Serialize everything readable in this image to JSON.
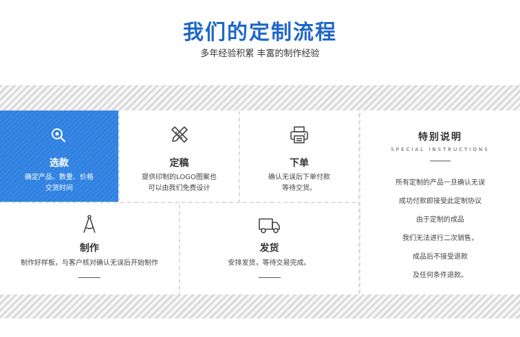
{
  "header": {
    "title": "我们的定制流程",
    "subtitle": "多年经验积累 丰富的制作经验"
  },
  "steps": [
    {
      "title": "选款",
      "desc_lines": [
        "确定产品、数量、价格",
        "交货时间"
      ],
      "icon": "search-icon"
    },
    {
      "title": "定稿",
      "desc_lines": [
        "提供印制的LOGO图案也",
        "可以由我们免费设计"
      ],
      "icon": "pencil-ruler-icon"
    },
    {
      "title": "下单",
      "desc_lines": [
        "确认无误后下单付款",
        "等待交货。"
      ],
      "icon": "printer-icon"
    },
    {
      "title": "制作",
      "desc_lines": [
        "制作好样板，与客户核对确认无误后开始制作"
      ],
      "icon": "compass-icon"
    },
    {
      "title": "发货",
      "desc_lines": [
        "安排发货，等待交易完成。"
      ],
      "icon": "truck-icon"
    }
  ],
  "special": {
    "title": "特别说明",
    "subtitle": "SPECIAL INSTRUCTIONS",
    "lines": [
      "所有定制的产品一旦确认无误",
      "成功付款即接受此定制协议",
      "由于定制的成品",
      "我们无法进行二次销售，",
      "成品后不接受退款",
      "及任何条件退款。"
    ]
  },
  "colors": {
    "accent": "#1f67c8",
    "active_card": "#2f80e0"
  }
}
